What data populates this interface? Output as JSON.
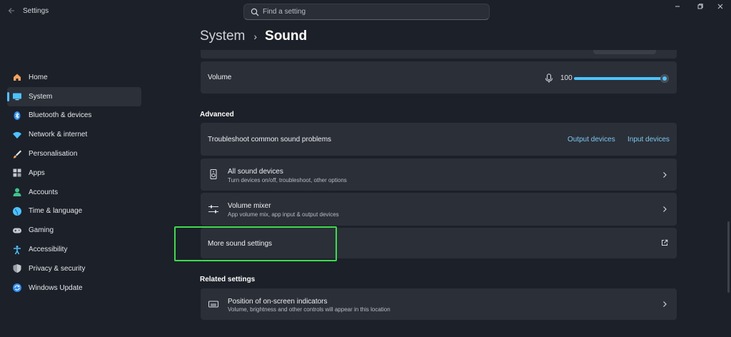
{
  "window": {
    "title": "Settings",
    "search_placeholder": "Find a setting",
    "controls": [
      "minimize",
      "maximize",
      "close"
    ]
  },
  "sidebar": {
    "items": [
      {
        "label": "Home",
        "icon": "home-icon",
        "active": false
      },
      {
        "label": "System",
        "icon": "system-icon",
        "active": true
      },
      {
        "label": "Bluetooth & devices",
        "icon": "bluetooth-icon",
        "active": false
      },
      {
        "label": "Network & internet",
        "icon": "wifi-icon",
        "active": false
      },
      {
        "label": "Personalisation",
        "icon": "brush-icon",
        "active": false
      },
      {
        "label": "Apps",
        "icon": "apps-icon",
        "active": false
      },
      {
        "label": "Accounts",
        "icon": "person-icon",
        "active": false
      },
      {
        "label": "Time & language",
        "icon": "globe-icon",
        "active": false
      },
      {
        "label": "Gaming",
        "icon": "gamepad-icon",
        "active": false
      },
      {
        "label": "Accessibility",
        "icon": "accessibility-icon",
        "active": false
      },
      {
        "label": "Privacy & security",
        "icon": "shield-icon",
        "active": false
      },
      {
        "label": "Windows Update",
        "icon": "update-icon",
        "active": false
      }
    ]
  },
  "breadcrumb": {
    "parent": "System",
    "separator": "›",
    "current": "Sound"
  },
  "volume": {
    "label": "Volume",
    "value": "100",
    "level": 1.0
  },
  "advanced": {
    "heading": "Advanced",
    "troubleshoot": {
      "label": "Troubleshoot common sound problems",
      "output_link": "Output devices",
      "input_link": "Input devices"
    },
    "all_devices": {
      "title": "All sound devices",
      "subtitle": "Turn devices on/off, troubleshoot, other options"
    },
    "volume_mixer": {
      "title": "Volume mixer",
      "subtitle": "App volume mix, app input & output devices"
    },
    "more_settings": {
      "title": "More sound settings"
    }
  },
  "related": {
    "heading": "Related settings",
    "indicators": {
      "title": "Position of on-screen indicators",
      "subtitle": "Volume, brightness and other controls will appear in this location"
    }
  },
  "colors": {
    "accent": "#4cc2ff",
    "link": "#7cc9f0",
    "highlight": "#3ddc4b",
    "background": "#1c2028",
    "card": "#2b2f37"
  }
}
